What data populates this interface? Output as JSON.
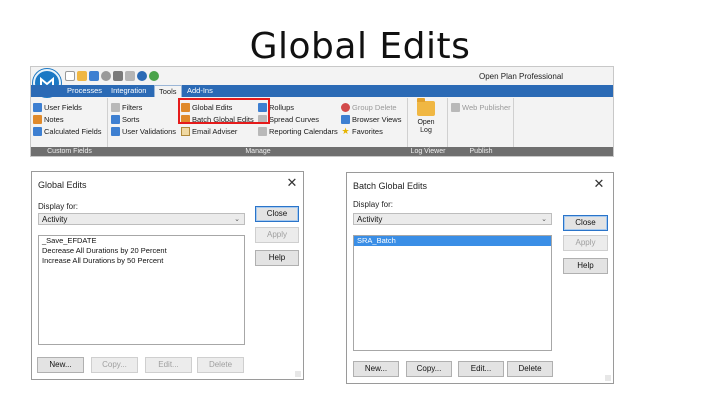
{
  "slide": {
    "title": "Global Edits"
  },
  "ribbon": {
    "app_name": "Open Plan Professional",
    "tabs": [
      "Processes",
      "Integration",
      "Tools",
      "Add-Ins"
    ],
    "active_tab": "Tools",
    "tools": {
      "user_fields": "User Fields",
      "notes": "Notes",
      "calculated_fields": "Calculated Fields",
      "filters": "Filters",
      "sorts": "Sorts",
      "user_validations": "User Validations",
      "global_edits": "Global Edits",
      "batch_global_edits": "Batch Global Edits",
      "email_adviser": "Email Adviser",
      "rollups": "Rollups",
      "spread_curves": "Spread Curves",
      "reporting_calendars": "Reporting Calendars",
      "group_delete": "Group Delete",
      "browser_views": "Browser Views",
      "favorites": "Favorites",
      "open_log": "Open Log",
      "web_publisher": "Web Publisher"
    },
    "groups": [
      "Custom Fields",
      "Manage",
      "Log Viewer",
      "Publish"
    ],
    "colors": {
      "tab_bar": "#2b6ab5",
      "highlight": "#e51b1b",
      "group_bar": "#6f6f6f"
    }
  },
  "dialog_left": {
    "title": "Global Edits",
    "display_for_label": "Display for:",
    "display_for_value": "Activity",
    "items": [
      "_Save_EFDATE",
      "Decrease All Durations by 20 Percent",
      "Increase All Durations by 50 Percent"
    ],
    "buttons": {
      "close": "Close",
      "apply": "Apply",
      "help": "Help",
      "new": "New...",
      "copy": "Copy...",
      "edit": "Edit...",
      "delete": "Delete"
    }
  },
  "dialog_right": {
    "title": "Batch Global Edits",
    "display_for_label": "Display for:",
    "display_for_value": "Activity",
    "items": [
      "SRA_Batch"
    ],
    "selected_item": "SRA_Batch",
    "buttons": {
      "close": "Close",
      "apply": "Apply",
      "help": "Help",
      "new": "New...",
      "copy": "Copy...",
      "edit": "Edit...",
      "delete": "Delete"
    }
  }
}
